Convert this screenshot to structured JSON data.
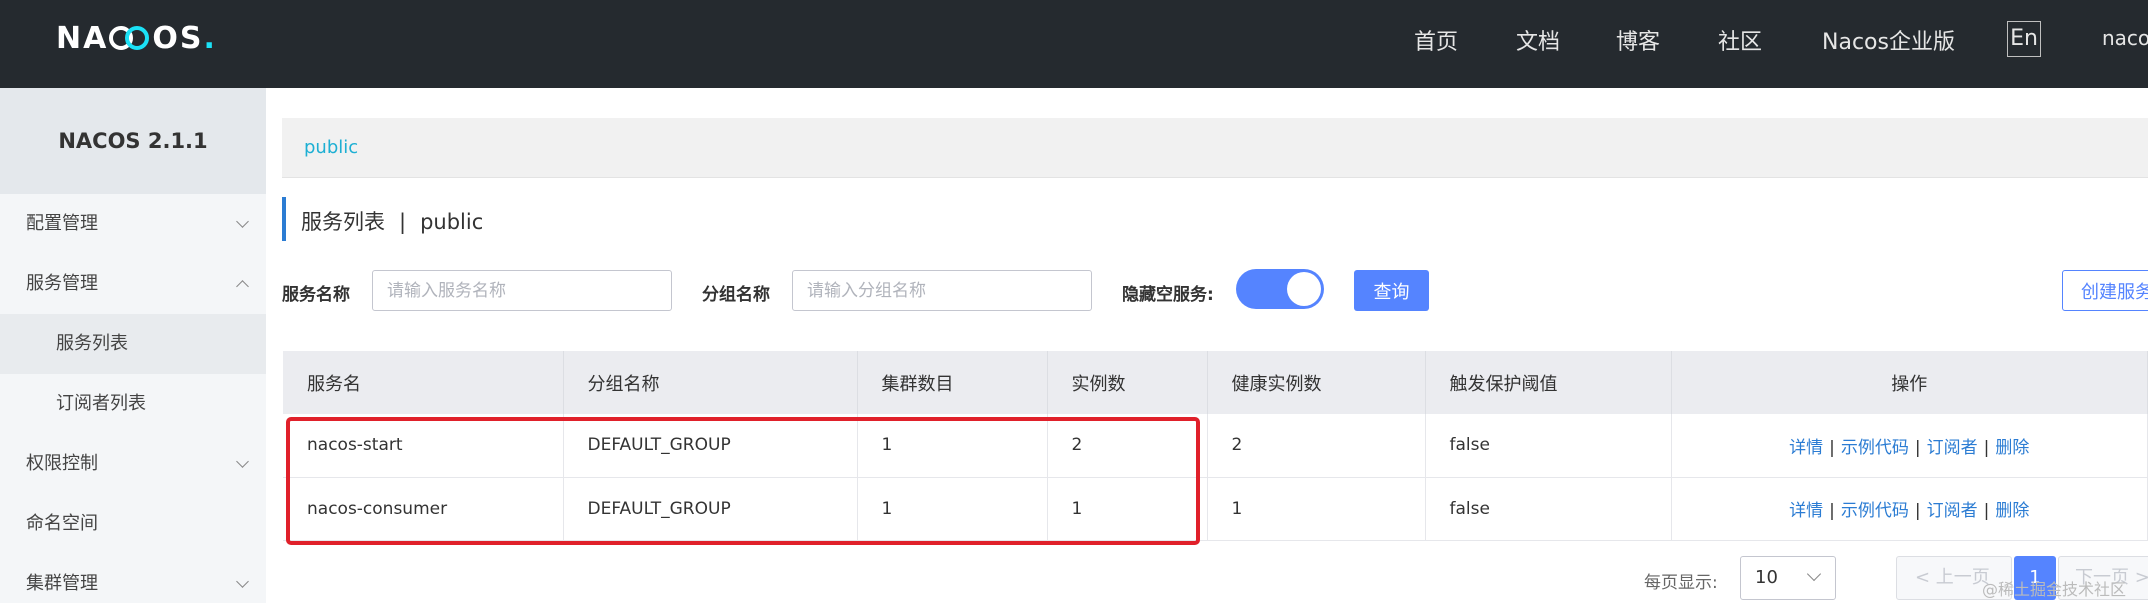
{
  "header": {
    "logo_text_1": "NA",
    "logo_text_2": "OS",
    "logo_dot": ".",
    "nav": [
      "首页",
      "文档",
      "博客",
      "社区",
      "Nacos企业版"
    ],
    "lang": "En",
    "user": "nacos"
  },
  "sidebar": {
    "version": "NACOS 2.1.1",
    "items": [
      {
        "label": "配置管理",
        "chevron": "chevron-down-icon"
      },
      {
        "label": "服务管理",
        "chevron": "chevron-up-icon"
      },
      {
        "label": "服务列表",
        "active": true
      },
      {
        "label": "订阅者列表"
      },
      {
        "label": "权限控制",
        "chevron": "chevron-down-icon"
      },
      {
        "label": "命名空间"
      },
      {
        "label": "集群管理",
        "chevron": "chevron-down-icon"
      }
    ]
  },
  "namespace_tag": "public",
  "page": {
    "title": "服务列表",
    "separator": "|",
    "namespace": "public"
  },
  "filters": {
    "service_name_label": "服务名称",
    "service_name_placeholder": "请输入服务名称",
    "group_name_label": "分组名称",
    "group_name_placeholder": "请输入分组名称",
    "hide_empty_label": "隐藏空服务:",
    "hide_empty_on": true,
    "query_button": "查询",
    "create_button": "创建服务"
  },
  "table": {
    "columns": [
      "服务名",
      "分组名称",
      "集群数目",
      "实例数",
      "健康实例数",
      "触发保护阈值",
      "操作"
    ],
    "rows": [
      {
        "name": "nacos-start",
        "group": "DEFAULT_GROUP",
        "clusters": "1",
        "instances": "2",
        "healthy": "2",
        "threshold": "false"
      },
      {
        "name": "nacos-consumer",
        "group": "DEFAULT_GROUP",
        "clusters": "1",
        "instances": "1",
        "healthy": "1",
        "threshold": "false"
      }
    ],
    "actions": {
      "detail": "详情",
      "sample": "示例代码",
      "subscribers": "订阅者",
      "delete": "删除"
    }
  },
  "pagination": {
    "page_size_label": "每页显示:",
    "page_size": "10",
    "prev": "< 上一页",
    "current": "1",
    "next": "下一页 >"
  },
  "watermark": "@稀土掘金技术社区",
  "colors": {
    "topbar": "#252a2f",
    "accent": "#5584ff",
    "link": "#2b7cd3",
    "highlight": "#e0202a"
  }
}
